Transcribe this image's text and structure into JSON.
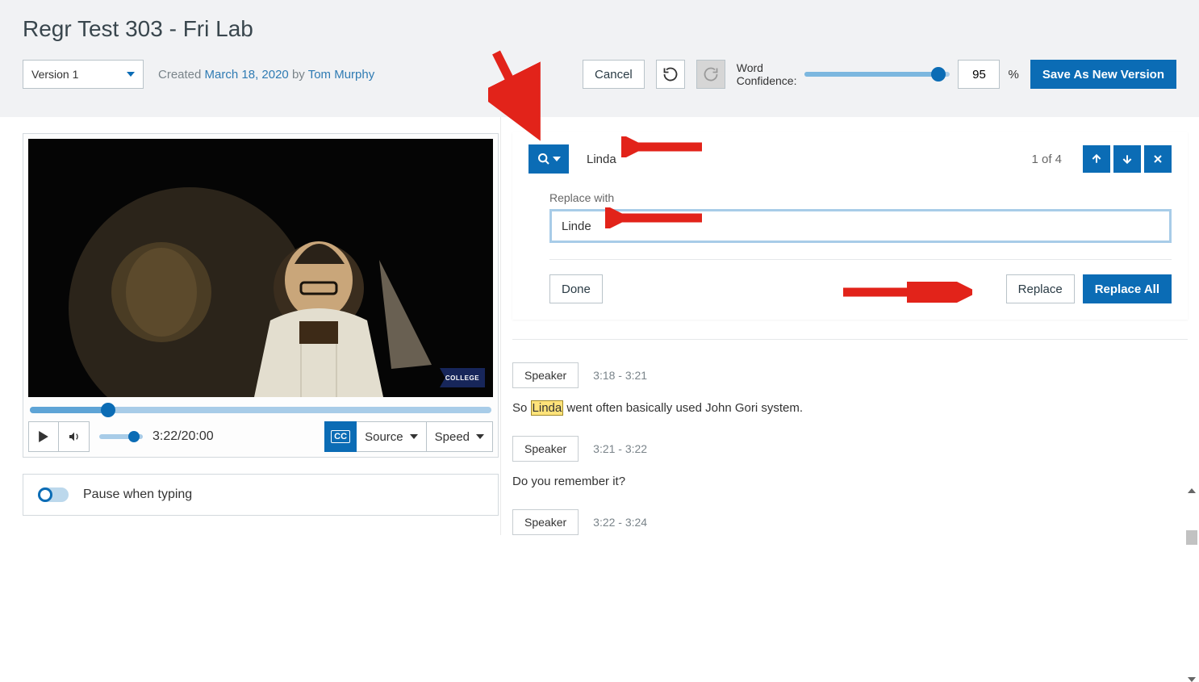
{
  "page": {
    "title": "Regr Test 303 - Fri Lab"
  },
  "meta": {
    "version_label": "Version 1",
    "created_prefix": "Created ",
    "created_date": "March 18, 2020",
    "by_prefix": " by ",
    "author": "Tom Murphy"
  },
  "toolbar": {
    "cancel": "Cancel",
    "word_confidence_label": "Word\nConfidence:",
    "confidence_value": "95",
    "percent": "%",
    "save_new_version": "Save As New Version"
  },
  "player": {
    "current_time": "3:22",
    "duration": "20:00",
    "timecode": "3:22/20:00",
    "source_label": "Source",
    "speed_label": "Speed",
    "cc_label": "CC",
    "pause_typing": "Pause when typing",
    "flag_text": "COLLEGE"
  },
  "search": {
    "term": "Linda",
    "count": "1 of 4",
    "replace_with_label": "Replace with",
    "replace_value": "Linde",
    "done": "Done",
    "replace": "Replace",
    "replace_all": "Replace All"
  },
  "transcript": {
    "speaker_label": "Speaker",
    "rows": [
      {
        "time": "3:18 - 3:21",
        "text_pre": "So ",
        "text_hl": "Linda",
        "text_post": " went often basically used John Gori system."
      },
      {
        "time": "3:21 - 3:22",
        "text_pre": "Do you remember it?",
        "text_hl": "",
        "text_post": ""
      },
      {
        "time": "3:22 - 3:24",
        "text_pre": "",
        "text_hl": "",
        "text_post": ""
      }
    ]
  }
}
